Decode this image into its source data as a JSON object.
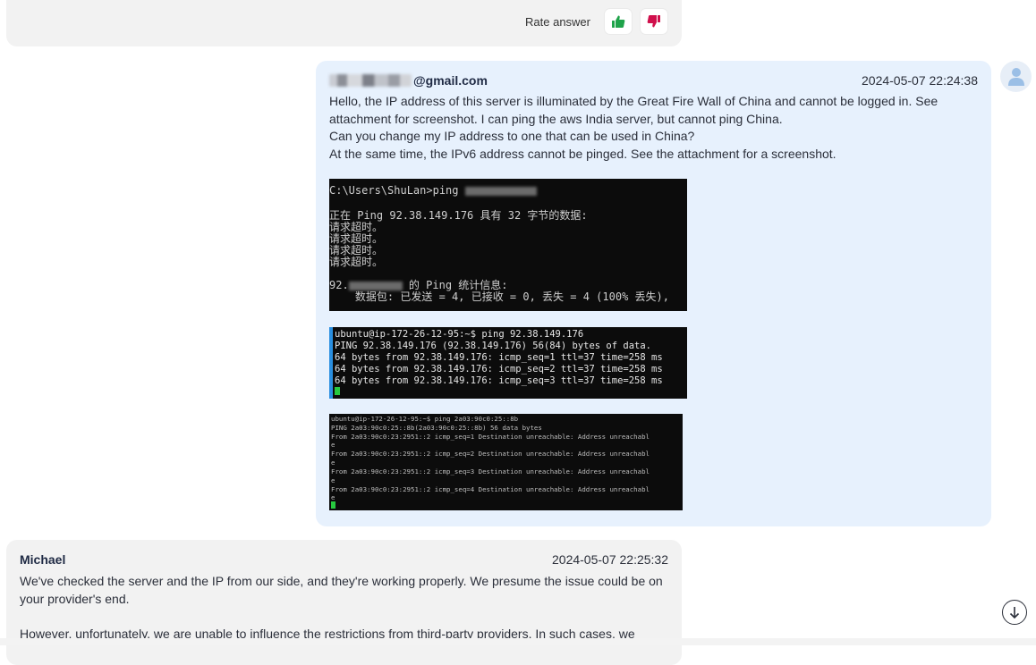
{
  "rating": {
    "label": "Rate answer",
    "thumbs_up_color": "#1fa34a",
    "thumbs_down_color": "#d0104c"
  },
  "user_message": {
    "sender_visible": "@gmail.com",
    "timestamp": "2024-05-07 22:24:38",
    "paragraphs": [
      "Hello, the IP address of this server is illuminated by the Great Fire Wall of China and cannot be logged in. See attachment for screenshot. I can ping the aws India server, but cannot ping China.",
      "Can you change my IP address to one that can be used in China?",
      "At the same time, the IPv6 address cannot be pinged. See the attachment for a screenshot."
    ]
  },
  "attachments": {
    "shot1": {
      "prompt": "C:\\Users\\ShuLan>ping",
      "line_ping": "正在 Ping 92.38.149.176 具有 32 字节的数据:",
      "timeouts": [
        "请求超时。",
        "请求超时。",
        "请求超时。",
        "请求超时。"
      ],
      "stats_prefix": "92.",
      "stats_suffix": "的 Ping 统计信息:",
      "packets": "    数据包: 已发送 = 4, 已接收 = 0, 丢失 = 4 (100% 丢失),"
    },
    "shot2": {
      "lines": [
        "ubuntu@ip-172-26-12-95:~$ ping 92.38.149.176",
        "PING 92.38.149.176 (92.38.149.176) 56(84) bytes of data.",
        "64 bytes from 92.38.149.176: icmp_seq=1 ttl=37 time=258 ms",
        "64 bytes from 92.38.149.176: icmp_seq=2 ttl=37 time=258 ms",
        "64 bytes from 92.38.149.176: icmp_seq=3 ttl=37 time=258 ms"
      ]
    },
    "shot3": {
      "lines": [
        "ubuntu@ip-172-26-12-95:~$ ping 2a03:90c0:25::8b",
        "PING 2a03:90c0:25::8b(2a03:90c0:25::8b) 56 data bytes",
        "From 2a03:90c0:23:2951::2 icmp_seq=1 Destination unreachable: Address unreachabl",
        "e",
        "From 2a03:90c0:23:2951::2 icmp_seq=2 Destination unreachable: Address unreachabl",
        "e",
        "From 2a03:90c0:23:2951::2 icmp_seq=3 Destination unreachable: Address unreachabl",
        "e",
        "From 2a03:90c0:23:2951::2 icmp_seq=4 Destination unreachable: Address unreachabl",
        "e"
      ]
    }
  },
  "agent_message": {
    "sender": "Michael",
    "timestamp": "2024-05-07 22:25:32",
    "paragraphs": [
      "We've checked the server and the IP from our side, and they're working properly. We presume the issue could be on your provider's end.",
      "However, unfortunately, we are unable to influence the restrictions from third-party providers. In such cases, we"
    ]
  },
  "icons": {
    "thumbs_up": "thumbs-up-icon",
    "thumbs_down": "thumbs-down-icon",
    "avatar": "user-avatar-icon",
    "scroll": "arrow-down-circle-icon"
  }
}
